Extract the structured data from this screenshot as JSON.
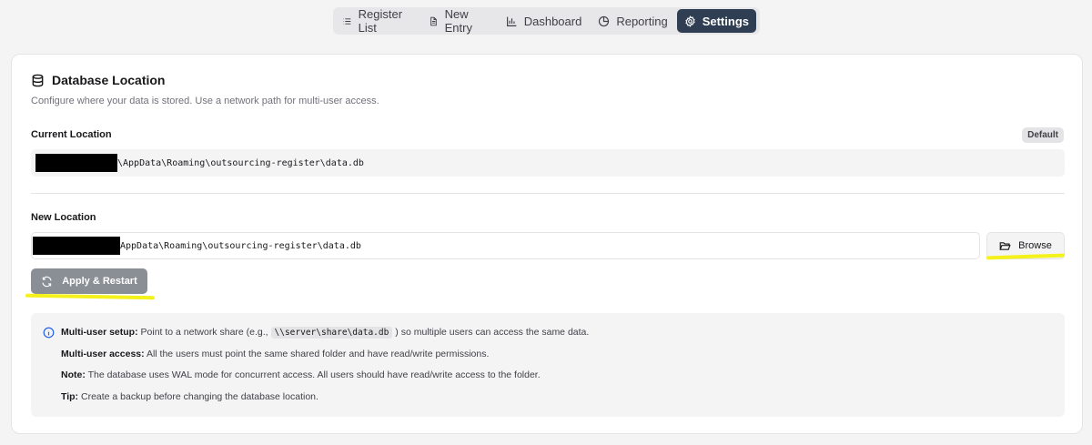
{
  "nav": {
    "items": [
      {
        "label": "Register List",
        "icon": "list-icon",
        "active": false
      },
      {
        "label": "New Entry",
        "icon": "file-text-icon",
        "active": false
      },
      {
        "label": "Dashboard",
        "icon": "bar-chart-icon",
        "active": false
      },
      {
        "label": "Reporting",
        "icon": "pie-chart-icon",
        "active": false
      },
      {
        "label": "Settings",
        "icon": "gear-icon",
        "active": true
      }
    ]
  },
  "database": {
    "title": "Database Location",
    "description": "Configure where your data is stored. Use a network path for multi-user access.",
    "current_label": "Current Location",
    "current_badge": "Default",
    "current_path_visible": "\\AppData\\Roaming\\outsourcing-register\\data.db",
    "new_label": "New Location",
    "new_path_visible": "AppData\\Roaming\\outsourcing-register\\data.db",
    "browse_label": "Browse",
    "apply_label": "Apply & Restart"
  },
  "info": {
    "line1_bold": "Multi-user setup:",
    "line1_pre": "Point to a network share (e.g.,",
    "line1_code": "\\\\server\\share\\data.db",
    "line1_post": ") so multiple users can access the same data.",
    "line2_bold": "Multi-user access:",
    "line2_text": "All the users must point the same shared folder and have read/write permissions.",
    "line3_bold": "Note:",
    "line3_text": "The database uses WAL mode for concurrent access. All users should have read/write access to the folder.",
    "line4_bold": "Tip:",
    "line4_text": "Create a backup before changing the database location."
  },
  "colors": {
    "active_nav": "#2f3e52",
    "apply_button": "#8a8f96",
    "highlight": "#f4f21a",
    "info_icon": "#2563eb"
  }
}
